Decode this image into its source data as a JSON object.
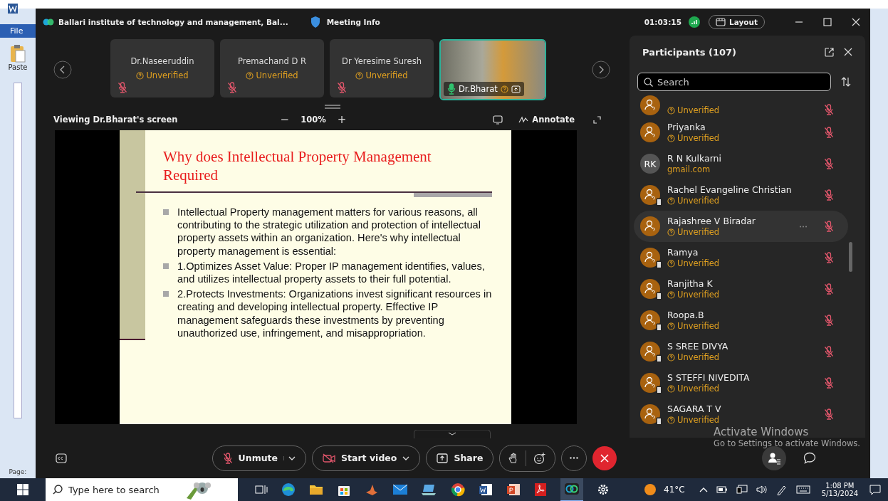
{
  "word": {
    "file_tab": "File",
    "paste": "Paste",
    "page": "Page:"
  },
  "window": {
    "title": "Ballari institute of technology and management, Bal...",
    "meeting_info": "Meeting Info",
    "timer": "01:03:15",
    "layout": "Layout"
  },
  "tiles": [
    {
      "kind": "name",
      "name": "Dr.Naseeruddin",
      "status": "Unverified",
      "muted": true,
      "speaking": false
    },
    {
      "kind": "name",
      "name": "Premachand D R",
      "status": "Unverified",
      "muted": true,
      "speaking": false
    },
    {
      "kind": "name",
      "name": "Dr Yeresime Suresh",
      "status": "Unverified",
      "muted": true,
      "speaking": false
    },
    {
      "kind": "video",
      "name": "Dr.Bharat",
      "muted": false,
      "speaking": true
    }
  ],
  "viewer": {
    "title": "Viewing Dr.Bharat's screen",
    "zoom_out": "−",
    "zoom": "100%",
    "zoom_in": "+",
    "annotate": "Annotate"
  },
  "slide": {
    "title": "Why does Intellectual Property Management Required",
    "bullets": [
      "Intellectual Property management matters for various reasons, all contributing to the strategic utilization and protection of intellectual property assets within an organization. Here's why intellectual property management is essential:",
      "1.Optimizes Asset Value: Proper IP management identifies, values, and utilizes intellectual property assets to their full potential.",
      "2.Protects Investments: Organizations invest significant resources in creating and developing intellectual property. Effective IP management safeguards these investments by preventing unauthorized use, infringement, and misappropriation."
    ]
  },
  "participants_panel": {
    "title": "Participants (107)",
    "search": {
      "placeholder": "Search"
    }
  },
  "participants": [
    {
      "kind": "icon",
      "status": "Unverified",
      "mobile": false,
      "muted": true,
      "selected": false
    },
    {
      "kind": "icon",
      "name": "Priyanka",
      "status": "Unverified",
      "mobile": false,
      "muted": true,
      "selected": false
    },
    {
      "kind": "initials",
      "initials": "RK",
      "name": "R N Kulkarni",
      "status": "gmail.com",
      "mobile": false,
      "muted": true,
      "selected": false
    },
    {
      "kind": "icon",
      "name": "Rachel Evangeline Christian",
      "status": "Unverified",
      "mobile": true,
      "muted": true,
      "selected": false
    },
    {
      "kind": "icon",
      "name": "Rajashree V Biradar",
      "status": "Unverified",
      "mobile": false,
      "muted": true,
      "selected": true
    },
    {
      "kind": "icon",
      "name": "Ramya",
      "status": "Unverified",
      "mobile": true,
      "muted": true,
      "selected": false
    },
    {
      "kind": "icon",
      "name": "Ranjitha K",
      "status": "Unverified",
      "mobile": true,
      "muted": true,
      "selected": false
    },
    {
      "kind": "icon",
      "name": "Roopa.B",
      "status": "Unverified",
      "mobile": true,
      "muted": true,
      "selected": false
    },
    {
      "kind": "icon",
      "name": "S SREE DIVYA",
      "status": "Unverified",
      "mobile": true,
      "muted": true,
      "selected": false
    },
    {
      "kind": "icon",
      "name": "S STEFFI NIVEDITA",
      "status": "Unverified",
      "mobile": true,
      "muted": true,
      "selected": false
    },
    {
      "kind": "icon",
      "name": "SAGARA T V",
      "status": "Unverified",
      "mobile": true,
      "muted": true,
      "selected": false
    }
  ],
  "controls": {
    "unmute": "Unmute",
    "start_video": "Start video",
    "share": "Share"
  },
  "activation": {
    "title": "Activate Windows",
    "text": "Go to Settings to activate Windows."
  },
  "taskbar": {
    "search_placeholder": "Type here to search",
    "temperature": "41°C",
    "time": "1:08 PM",
    "date": "5/13/2024"
  }
}
